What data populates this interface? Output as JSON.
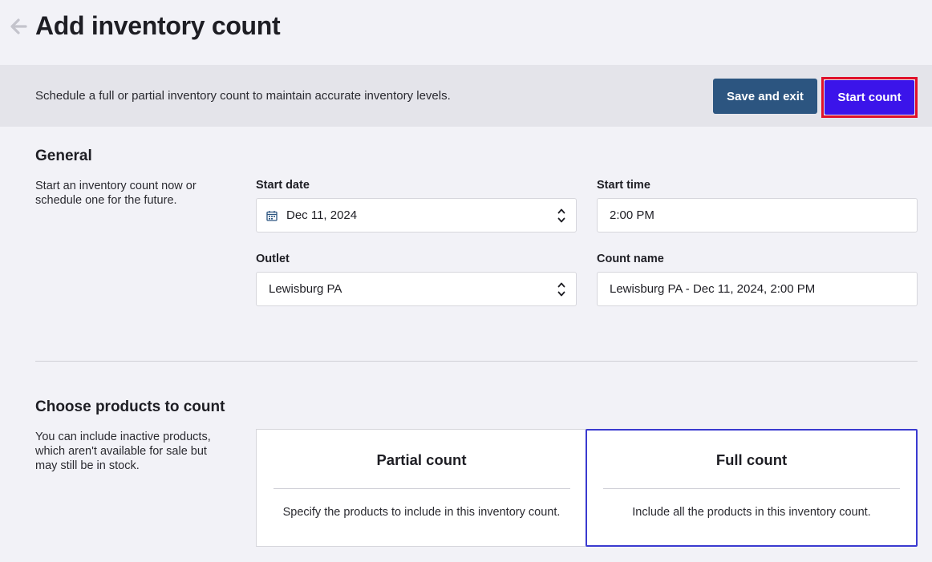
{
  "header": {
    "title": "Add inventory count",
    "back_icon": "arrow-left-icon"
  },
  "action_bar": {
    "description": "Schedule a full or partial inventory count to maintain accurate inventory levels.",
    "save_label": "Save and exit",
    "start_label": "Start count"
  },
  "general": {
    "title": "General",
    "description": "Start an inventory count now or schedule one for the future.",
    "start_date": {
      "label": "Start date",
      "value": "Dec 11, 2024",
      "icon": "calendar-icon"
    },
    "start_time": {
      "label": "Start time",
      "value": "2:00 PM"
    },
    "outlet": {
      "label": "Outlet",
      "value": "Lewisburg PA"
    },
    "count_name": {
      "label": "Count name",
      "value": "Lewisburg PA - Dec 11, 2024, 2:00 PM"
    }
  },
  "products": {
    "title": "Choose products to count",
    "description": "You can include inactive products, which aren't available for sale but may still be in stock.",
    "options": [
      {
        "title": "Partial count",
        "description": "Specify the products to include in this inventory count.",
        "selected": false
      },
      {
        "title": "Full count",
        "description": "Include all the products in this inventory count.",
        "selected": true
      }
    ]
  },
  "colors": {
    "background": "#f2f2f7",
    "action_bar": "#e4e4ea",
    "save_button": "#2c5580",
    "start_button": "#3b14ea",
    "highlight_outline": "#e0102a",
    "selected_card_border": "#3a3ad0"
  }
}
